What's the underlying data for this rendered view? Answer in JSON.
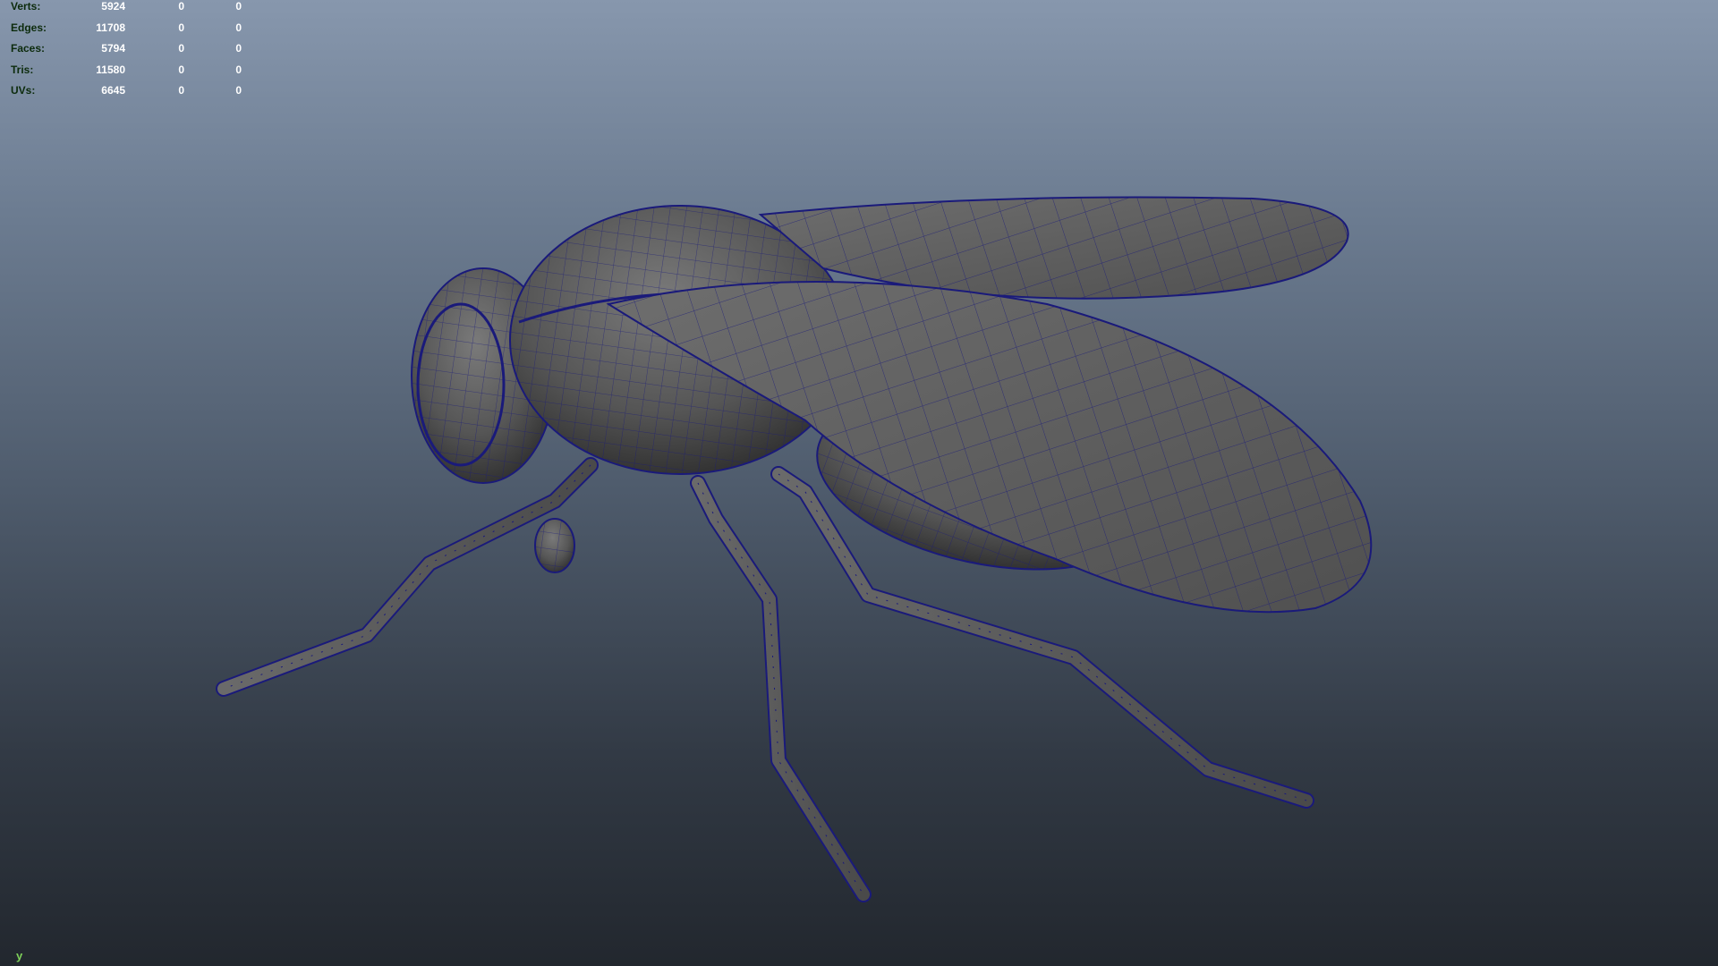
{
  "hud": {
    "rows": [
      {
        "label": "Verts:",
        "values": [
          "5924",
          "0",
          "0"
        ]
      },
      {
        "label": "Edges:",
        "values": [
          "11708",
          "0",
          "0"
        ]
      },
      {
        "label": "Faces:",
        "values": [
          "5794",
          "0",
          "0"
        ]
      },
      {
        "label": "Tris:",
        "values": [
          "11580",
          "0",
          "0"
        ]
      },
      {
        "label": "UVs:",
        "values": [
          "6645",
          "0",
          "0"
        ]
      }
    ]
  },
  "axis_label": "y",
  "colors": {
    "wireframe": "#1a1a7a",
    "surface": "#5c5c5c",
    "hud_label": "#0c2b0c",
    "hud_value": "#ffffff",
    "axis": "#7fd35a"
  }
}
